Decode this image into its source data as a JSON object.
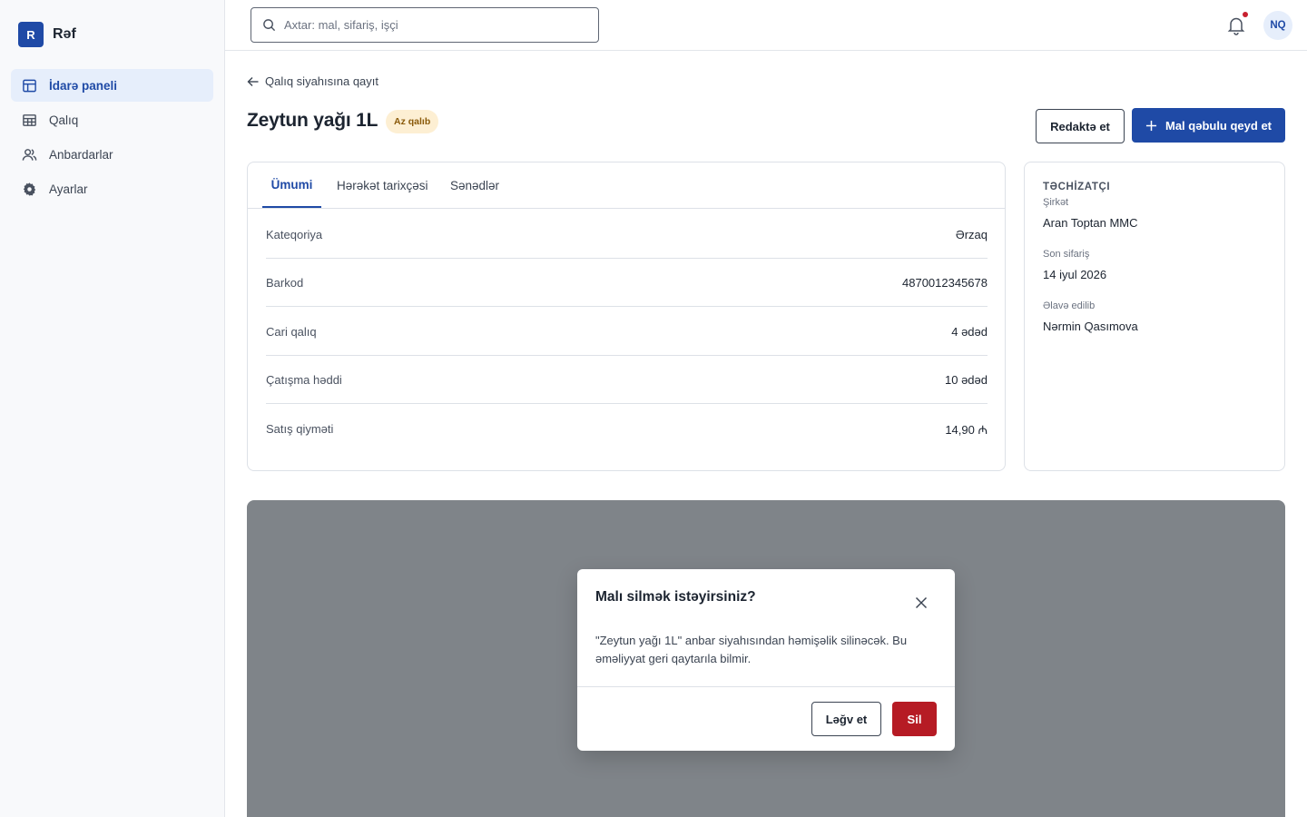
{
  "brand": {
    "logo_letter": "R",
    "name": "Rəf"
  },
  "sidebar": {
    "items": [
      {
        "label": "İdarə paneli",
        "icon": "dashboard-icon",
        "active": true
      },
      {
        "label": "Qalıq",
        "icon": "table-icon",
        "active": false
      },
      {
        "label": "Anbardarlar",
        "icon": "users-icon",
        "active": false
      },
      {
        "label": "Ayarlar",
        "icon": "gear-icon",
        "active": false
      }
    ]
  },
  "topbar": {
    "search_placeholder": "Axtar: mal, sifariş, işçi",
    "notifications_icon": "bell-icon",
    "has_unread": true,
    "avatar_initials": "NQ"
  },
  "page": {
    "back_label": "Qalıq siyahısına qayıt",
    "title": "Zeytun yağı 1L",
    "badge": "Az qalıb",
    "edit_label": "Redaktə et",
    "primary_label": "Mal qəbulu qeyd et"
  },
  "tabs": [
    {
      "label": "Ümumi",
      "active": true
    },
    {
      "label": "Hərəkət tarixçəsi",
      "active": false
    },
    {
      "label": "Sənədlər",
      "active": false
    }
  ],
  "details": [
    {
      "label": "Kateqoriya",
      "value": "Ərzaq"
    },
    {
      "label": "Barkod",
      "value": "4870012345678"
    },
    {
      "label": "Cari qalıq",
      "value": "4 ədəd"
    },
    {
      "label": "Çatışma həddi",
      "value": "10 ədəd"
    },
    {
      "label": "Satış qiyməti",
      "value": "14,90 ₼"
    }
  ],
  "supplier": {
    "title": "TƏCHİZATÇI",
    "fields": [
      {
        "label": "Şirkət",
        "value": "Aran Toptan MMC"
      },
      {
        "label": "Son sifariş",
        "value": "14 iyul 2026"
      },
      {
        "label": "Əlavə edilib",
        "value": "Nərmin Qasımova"
      }
    ]
  },
  "modal": {
    "title": "Malı silmək istəyirsiniz?",
    "body": "\"Zeytun yağı 1L\" anbar siyahısından həmişəlik silinəcək. Bu əməliyyat geri qaytarıla bilmir.",
    "cancel_label": "Ləğv et",
    "delete_label": "Sil"
  },
  "colors": {
    "accent": "#1f4aa6",
    "danger": "#b61b24",
    "badge_bg": "#fdefd3",
    "overlay": "#7f8489"
  }
}
